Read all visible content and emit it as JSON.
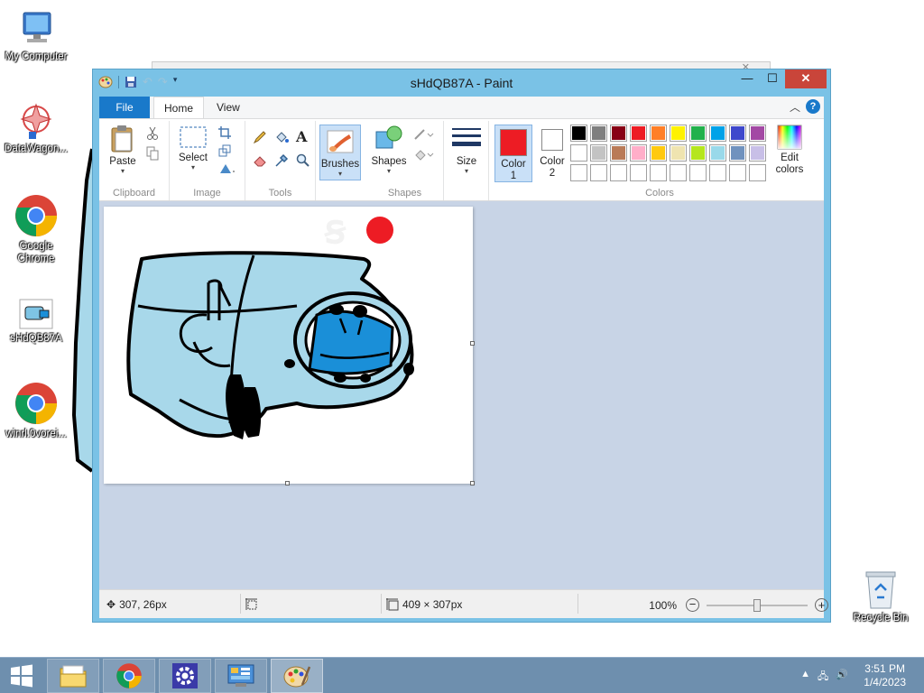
{
  "desktop": {
    "icons": [
      {
        "label": "My Computer"
      },
      {
        "label": "DataWagon..."
      },
      {
        "label": "Google Chrome"
      },
      {
        "label": "sHdQB87A"
      },
      {
        "label": "winrl.0vorei..."
      },
      {
        "label": "Recycle Bin"
      }
    ]
  },
  "window": {
    "title": "sHdQB87A - Paint",
    "tabs": {
      "file": "File",
      "home": "Home",
      "view": "View"
    },
    "ribbon": {
      "clipboard": {
        "label": "Clipboard",
        "paste": "Paste"
      },
      "image": {
        "label": "Image",
        "select": "Select"
      },
      "tools": {
        "label": "Tools"
      },
      "brushes": {
        "label": "Brushes"
      },
      "shapes": {
        "label": "Shapes",
        "button": "Shapes"
      },
      "size": {
        "label": "Size"
      },
      "color1": {
        "label_line1": "Color",
        "label_line2": "1",
        "value": "#ed1c24"
      },
      "color2": {
        "label_line1": "Color",
        "label_line2": "2",
        "value": "#ffffff"
      },
      "colors": {
        "label": "Colors",
        "edit_line1": "Edit",
        "edit_line2": "colors"
      },
      "palette_row1": [
        "#000000",
        "#7f7f7f",
        "#880015",
        "#ed1c24",
        "#ff7f27",
        "#fff200",
        "#22b14c",
        "#00a2e8",
        "#3f48cc",
        "#a349a4"
      ],
      "palette_row2": [
        "#ffffff",
        "#c3c3c3",
        "#b97a57",
        "#ffaec9",
        "#ffc90e",
        "#efe4b0",
        "#b5e61d",
        "#99d9ea",
        "#7092be",
        "#c8bfe7"
      ],
      "palette_row3": [
        "#ffffff",
        "#ffffff",
        "#ffffff",
        "#ffffff",
        "#ffffff",
        "#ffffff",
        "#ffffff",
        "#ffffff",
        "#ffffff",
        "#ffffff"
      ]
    },
    "status": {
      "cursor": "307, 26px",
      "canvas_size": "409 × 307px",
      "zoom": "100%",
      "zoom_level": 1.0
    }
  },
  "taskbar": {
    "time": "3:51 PM",
    "date": "1/4/2023"
  },
  "colors": {
    "drawing_fill": "#a8d8ea",
    "drawing_blue": "#1a8fd8",
    "dot": "#ed1c24"
  }
}
